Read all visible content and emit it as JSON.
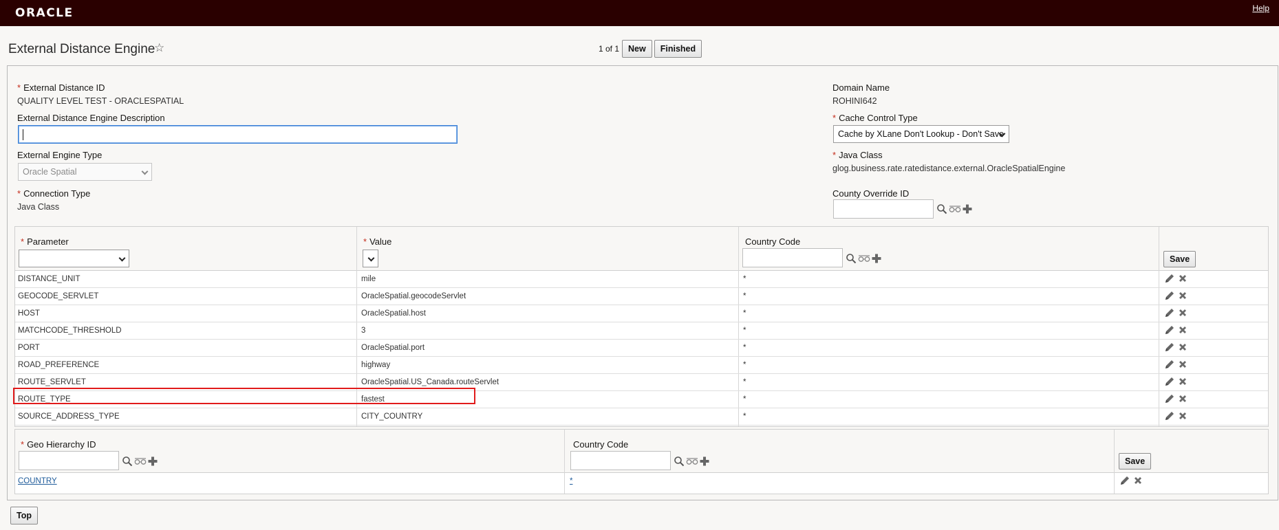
{
  "header": {
    "logo": "ORACLE",
    "help": "Help"
  },
  "page": {
    "title": "External Distance Engine",
    "pager": "1 of 1",
    "new_label": "New",
    "finished_label": "Finished",
    "top_label": "Top"
  },
  "form": {
    "external_distance_id_label": "External Distance ID",
    "external_distance_id_value": "QUALITY LEVEL TEST - ORACLESPATIAL",
    "description_label": "External Distance Engine Description",
    "description_value": "",
    "engine_type_label": "External Engine Type",
    "engine_type_value": "Oracle Spatial",
    "connection_type_label": "Connection Type",
    "connection_type_value": "Java Class",
    "domain_name_label": "Domain Name",
    "domain_name_value": "ROHINI642",
    "cache_control_label": "Cache Control Type",
    "cache_control_value": "Cache by XLane Don't Lookup - Don't Save",
    "java_class_label": "Java Class",
    "java_class_value": "glog.business.rate.ratedistance.external.OracleSpatialEngine",
    "county_override_label": "County Override ID",
    "county_override_value": ""
  },
  "param_grid": {
    "col_parameter": "Parameter",
    "col_value": "Value",
    "col_country": "Country Code",
    "save_label": "Save",
    "rows": [
      {
        "parameter": "DISTANCE_UNIT",
        "value": "mile",
        "country": "*"
      },
      {
        "parameter": "GEOCODE_SERVLET",
        "value": "OracleSpatial.geocodeServlet",
        "country": "*"
      },
      {
        "parameter": "HOST",
        "value": "OracleSpatial.host",
        "country": "*"
      },
      {
        "parameter": "MATCHCODE_THRESHOLD",
        "value": "3",
        "country": "*"
      },
      {
        "parameter": "PORT",
        "value": "OracleSpatial.port",
        "country": "*"
      },
      {
        "parameter": "ROAD_PREFERENCE",
        "value": "highway",
        "country": "*"
      },
      {
        "parameter": "ROUTE_SERVLET",
        "value": "OracleSpatial.US_Canada.routeServlet",
        "country": "*"
      },
      {
        "parameter": "ROUTE_TYPE",
        "value": "fastest",
        "country": "*"
      },
      {
        "parameter": "SOURCE_ADDRESS_TYPE",
        "value": "CITY_COUNTRY",
        "country": "*"
      }
    ]
  },
  "geo_grid": {
    "col_geo": "Geo Hierarchy ID",
    "col_country": "Country Code",
    "save_label": "Save",
    "rows": [
      {
        "geo": "COUNTRY",
        "country": "*"
      }
    ]
  },
  "colors": {
    "header_bg": "#2a0000",
    "required": "#c42d1c",
    "highlight": "#e11b1b",
    "link": "#1e5b9a"
  }
}
